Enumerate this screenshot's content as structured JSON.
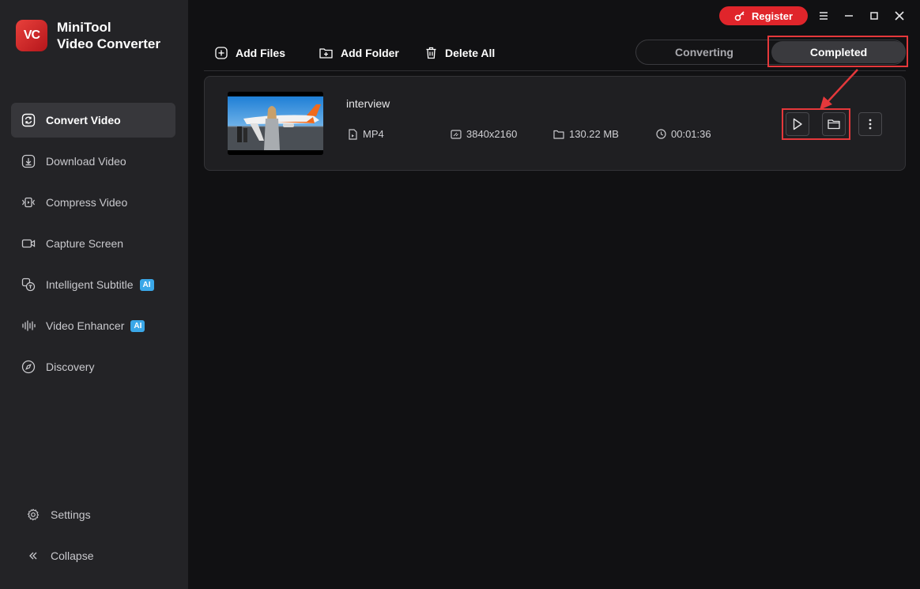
{
  "app": {
    "brand_line1": "MiniTool",
    "brand_line2": "Video Converter",
    "logo_text": "VC",
    "brand_color": "#e0252b"
  },
  "sidebar": {
    "items": [
      {
        "label": "Convert Video",
        "icon": "convert-icon",
        "active": true
      },
      {
        "label": "Download Video",
        "icon": "download-icon"
      },
      {
        "label": "Compress Video",
        "icon": "compress-icon"
      },
      {
        "label": "Capture Screen",
        "icon": "camera-icon"
      },
      {
        "label": "Intelligent Subtitle",
        "icon": "subtitle-icon",
        "badge": "AI"
      },
      {
        "label": "Video Enhancer",
        "icon": "enhancer-icon",
        "badge": "AI"
      },
      {
        "label": "Discovery",
        "icon": "compass-icon"
      }
    ],
    "settings_label": "Settings",
    "collapse_label": "Collapse"
  },
  "header": {
    "register_label": "Register"
  },
  "toolbar": {
    "add_files": "Add Files",
    "add_folder": "Add Folder",
    "delete_all": "Delete All"
  },
  "tabs": {
    "converting": "Converting",
    "completed": "Completed",
    "selected": "Completed"
  },
  "file": {
    "name": "interview",
    "format": "MP4",
    "resolution": "3840x2160",
    "size": "130.22 MB",
    "duration": "00:01:36"
  },
  "colors": {
    "accent_highlight": "#e5383b",
    "ai_badge": "#3aa7e8"
  }
}
